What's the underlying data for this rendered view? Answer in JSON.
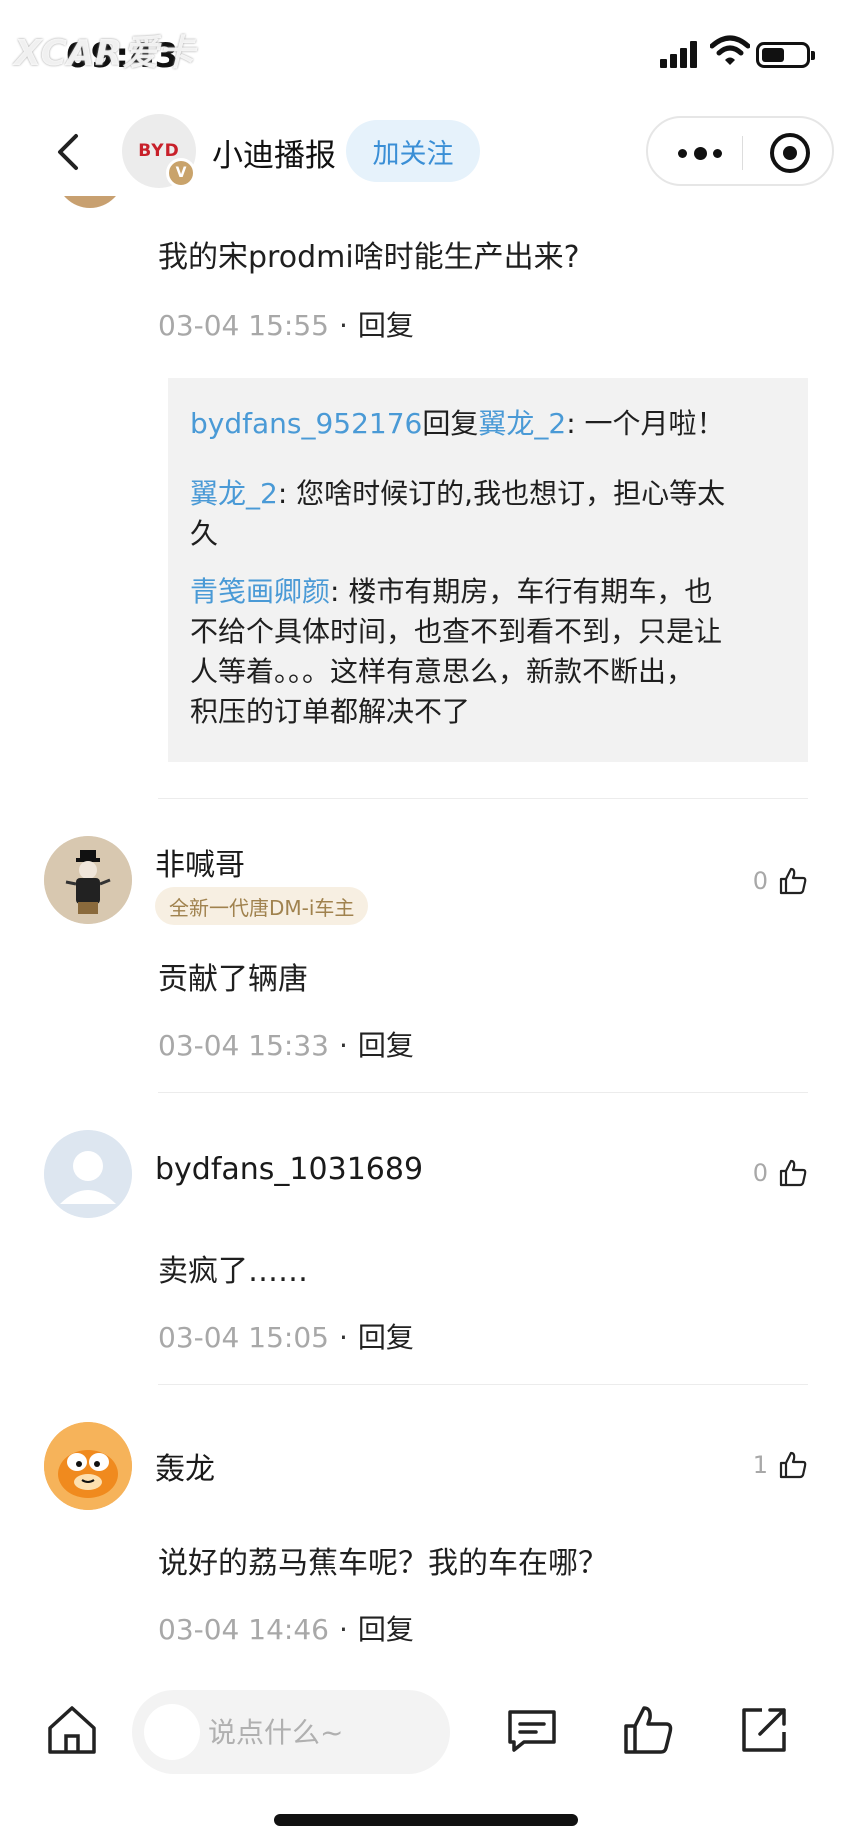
{
  "status_bar": {
    "time": "09:43",
    "watermark": "XCAR爱卡"
  },
  "header": {
    "account_name": "小迪播报",
    "follow_label": "加关注",
    "logo_text": "BYD",
    "verified_mark": "V"
  },
  "comments": [
    {
      "text": "我的宋prodmi啥时能生产出来?",
      "date": "03-04 15:55",
      "reply_label": "回复",
      "replies": [
        {
          "user": "bydfans_952176",
          "reply_word": "回复",
          "target": "翼龙_2",
          "text": ": 一个月啦！"
        },
        {
          "user": "翼龙_2",
          "text_line1": ": 您啥时候订的,我也想订，担心等太",
          "text_line2": "久"
        },
        {
          "user": "青笺画卿颜",
          "text_line1": ": 楼市有期房，车行有期车，也",
          "text_line2": "不给个具体时间，也查不到看不到，只是让",
          "text_line3": "人等着。。。这样有意思么，新款不断出，",
          "text_line4": "积压的订单都解决不了"
        }
      ]
    },
    {
      "user": "非喊哥",
      "tag": "全新一代唐DM-i车主",
      "likes": "0",
      "text": "贡献了辆唐",
      "date": "03-04 15:33",
      "reply_label": "回复"
    },
    {
      "user": "bydfans_1031689",
      "likes": "0",
      "text": "卖疯了……",
      "date": "03-04 15:05",
      "reply_label": "回复"
    },
    {
      "user": "轰龙",
      "likes": "1",
      "text": "说好的荔马蕉车呢？我的车在哪？",
      "date": "03-04 14:46",
      "reply_label": "回复"
    }
  ],
  "bottom_bar": {
    "input_placeholder": "说点什么~"
  },
  "colors": {
    "accent_blue": "#4a9ad6",
    "follow_bg": "#e6f2fb",
    "tag_bg": "#f7efe2",
    "tag_text": "#a0824e",
    "byd_red": "#c8202a"
  }
}
